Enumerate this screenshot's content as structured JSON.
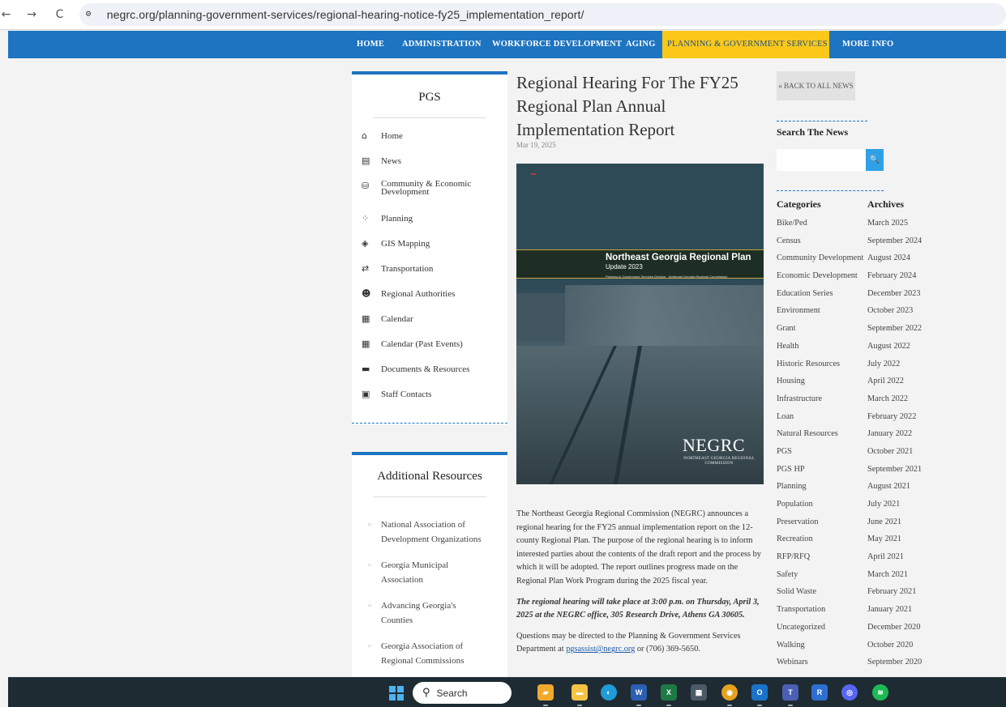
{
  "browser": {
    "back": "←",
    "forward": "→",
    "reload": "C",
    "site_info": "⚙",
    "url": "negrc.org/planning-government-services/regional-hearing-notice-fy25_implementation_report/"
  },
  "nav": [
    {
      "label": "HOME",
      "active": false
    },
    {
      "label": "ADMINISTRATION",
      "active": false
    },
    {
      "label": "WORKFORCE DEVELOPMENT",
      "active": false
    },
    {
      "label": "AGING",
      "active": false
    },
    {
      "label": "PLANNING & GOVERNMENT SERVICES",
      "active": true
    },
    {
      "label": "MORE INFO",
      "active": false
    }
  ],
  "sidebar": {
    "title": "PGS",
    "items": [
      {
        "label": "Home",
        "icon": "home-icon",
        "glyph": "⌂"
      },
      {
        "label": "News",
        "icon": "newspaper-icon",
        "glyph": "▤"
      },
      {
        "label": "Community & Economic Development",
        "icon": "coins-icon",
        "glyph": "⛁"
      },
      {
        "label": "Planning",
        "icon": "network-icon",
        "glyph": "⁘"
      },
      {
        "label": "GIS Mapping",
        "icon": "map-icon",
        "glyph": "◈"
      },
      {
        "label": "Transportation",
        "icon": "exchange-icon",
        "glyph": "⇄"
      },
      {
        "label": "Regional Authorities",
        "icon": "users-icon",
        "glyph": "☻"
      },
      {
        "label": "Calendar",
        "icon": "calendar-icon",
        "glyph": "▦"
      },
      {
        "label": "Calendar (Past Events)",
        "icon": "calendar-past-icon",
        "glyph": "▦"
      },
      {
        "label": "Documents & Resources",
        "icon": "folder-icon",
        "glyph": "▬"
      },
      {
        "label": "Staff Contacts",
        "icon": "id-card-icon",
        "glyph": "▣"
      }
    ]
  },
  "resources": {
    "title": "Additional Resources",
    "items": [
      "National Association of Development Organizations",
      "Georgia Municipal Association",
      "Advancing Georgia's Counties",
      "Georgia Association of Regional Commissions"
    ]
  },
  "article": {
    "title": "Regional Hearing For The FY25 Regional Plan Annual Implementation Report",
    "date": "Mar 19, 2025",
    "hero": {
      "plan_title": "Northeast Georgia Regional Plan",
      "plan_update": "Update 2023",
      "plan_sub": "Planning & Government Services Division · Northeast Georgia Regional Commission",
      "logo": "NEGRC",
      "logo_sub": "NORTHEAST GEORGIA REGIONAL COMMISSION"
    },
    "p1": "The Northeast Georgia Regional Commission (NEGRC) announces a regional hearing for the FY25 annual implementation report on the 12-county Regional Plan.  The purpose of the regional hearing is to inform interested parties about the contents of the draft report and the process by which it will be adopted. The report outlines progress made on the Regional Plan Work Program during the 2025 fiscal year.",
    "p2": "The regional hearing will take place at 3:00 p.m. on Thursday, April 3, 2025 at the NEGRC office, 305 Research Drive, Athens GA 30605.",
    "p3_prefix": "Questions may be directed to the Planning & Government Services Department at ",
    "p3_email": "pgsassist@negrc.org",
    "p3_suffix": " or (706) 369-5650."
  },
  "right": {
    "back_label": "« BACK TO ALL NEWS",
    "search_heading": "Search The News",
    "search_value": "",
    "search_button": "🔍",
    "categories_heading": "Categories",
    "archives_heading": "Archives",
    "categories": [
      "Bike/Ped",
      "Census",
      "Community Development",
      "Economic Development",
      "Education Series",
      "Environment",
      "Grant",
      "Health",
      "Historic Resources",
      "Housing",
      "Infrastructure",
      "Loan",
      "Natural Resources",
      "PGS",
      "PGS HP",
      "Planning",
      "Population",
      "Preservation",
      "Recreation",
      "RFP/RFQ",
      "Safety",
      "Solid Waste",
      "Transportation",
      "Uncategorized",
      "Walking",
      "Webinars"
    ],
    "archives": [
      "March 2025",
      "September 2024",
      "August 2024",
      "February 2024",
      "December 2023",
      "October 2023",
      "September 2022",
      "August 2022",
      "July 2022",
      "April 2022",
      "March 2022",
      "February 2022",
      "January 2022",
      "October 2021",
      "September 2021",
      "August 2021",
      "July 2021",
      "June 2021",
      "May 2021",
      "April 2021",
      "March 2021",
      "February 2021",
      "January 2021",
      "December 2020",
      "October 2020",
      "September 2020"
    ]
  },
  "taskbar": {
    "search_label": "Search",
    "search_glyph": "⚲",
    "apps": [
      {
        "name": "file-manager-icon",
        "glyph": "▰",
        "color": "#f0a92b"
      },
      {
        "name": "file-explorer-icon",
        "glyph": "▬",
        "color": "#f5c342"
      },
      {
        "name": "edge-icon",
        "glyph": "◐",
        "color": "#1f9bd6"
      },
      {
        "name": "word-icon",
        "glyph": "W",
        "color": "#2b5fb3"
      },
      {
        "name": "excel-icon",
        "glyph": "X",
        "color": "#1e7a45"
      },
      {
        "name": "calculator-icon",
        "glyph": "▦",
        "color": "#4a5a66"
      },
      {
        "name": "chrome-icon",
        "glyph": "◉",
        "color": "#e5a21d"
      },
      {
        "name": "outlook-icon",
        "glyph": "O",
        "color": "#1a73c8"
      },
      {
        "name": "teams-icon",
        "glyph": "T",
        "color": "#4b5fb6"
      },
      {
        "name": "r-app-icon",
        "glyph": "R",
        "color": "#2d6fd1"
      },
      {
        "name": "discord-icon",
        "glyph": "◎",
        "color": "#5865f2"
      },
      {
        "name": "spotify-icon",
        "glyph": "≋",
        "color": "#1db954"
      }
    ]
  }
}
